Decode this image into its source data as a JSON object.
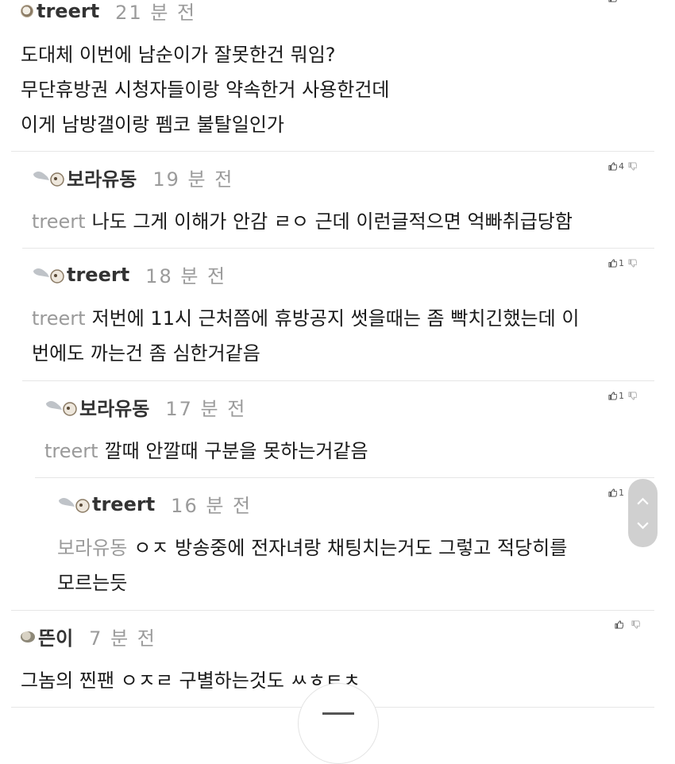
{
  "comments": [
    {
      "author": "treert",
      "time": "21 분 전",
      "mention": "",
      "lines": [
        "도대체 이번에 남순이가 잘못한건 뭐임?",
        "무단휴방권 시청자들이랑 약속한거 사용한건데",
        "이게 남방갤이랑 펨코 불탈일인가"
      ],
      "votes": ""
    },
    {
      "author": "보라유동",
      "time": "19 분 전",
      "mention": "treert",
      "lines": [
        "나도 그게 이해가 안감 ㄹㅇ 근데 이런글적으면 억빠취급당함"
      ],
      "votes": "4"
    },
    {
      "author": "treert",
      "time": "18 분 전",
      "mention": "treert",
      "lines": [
        "저번에 11시 근처쯤에 휴방공지 썻을때는 좀 빡치긴했는데 이",
        "번에도 까는건 좀 심한거같음"
      ],
      "votes": "1"
    },
    {
      "author": "보라유동",
      "time": "17 분 전",
      "mention": "treert",
      "lines": [
        "깔때 안깔때 구분을 못하는거같음"
      ],
      "votes": "1"
    },
    {
      "author": "treert",
      "time": "16 분 전",
      "mention": "보라유동",
      "lines": [
        "ㅇㅈ 방송중에 전자녀랑 채팅치는거도 그렇고 적당히를",
        "모르는듯"
      ],
      "votes": "1"
    },
    {
      "author": "뜬이",
      "time": "7 분 전",
      "mention": "",
      "lines": [
        "그놈의 찐팬 ㅇㅈㄹ 구별하는것도 ㅆㅎㅌㅊ"
      ],
      "votes": ""
    }
  ],
  "icons": {
    "upvote": "thumbs-up-icon",
    "downvote": "thumbs-down-icon",
    "scroll_up": "chevron-up-icon",
    "scroll_down": "chevron-down-icon"
  }
}
